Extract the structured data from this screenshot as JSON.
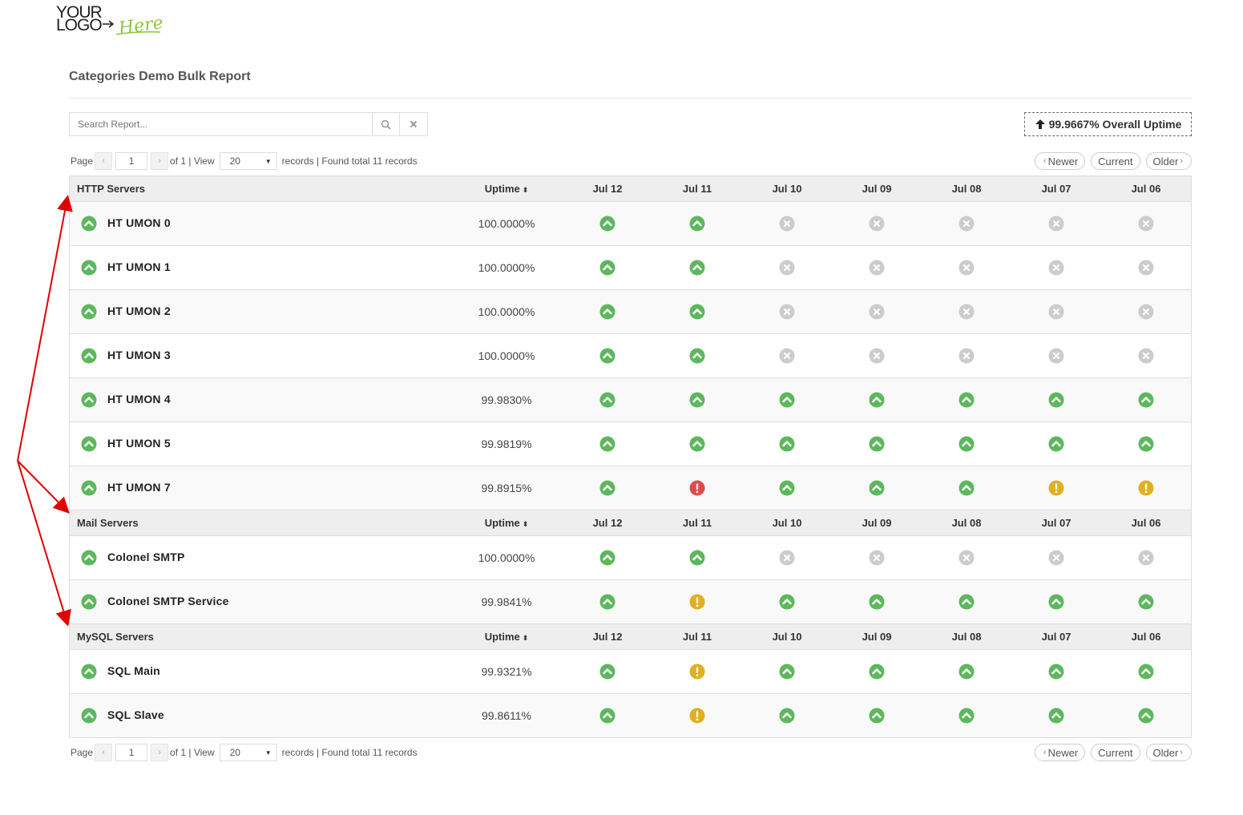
{
  "logo": {
    "line1": "YOUR",
    "line2": "LOGO",
    "accent": "Here"
  },
  "page_title": "Categories Demo Bulk Report",
  "search": {
    "placeholder": "Search Report..."
  },
  "overall_uptime": {
    "value": "99.9667% Overall Uptime",
    "icon": "arrow-up-icon"
  },
  "pager": {
    "page_label": "Page",
    "prev": "‹",
    "page": "1",
    "next": "›",
    "of_text": "of 1 | View",
    "view": "20",
    "records_text": "records | Found total 11 records"
  },
  "nav": {
    "newer": "Newer",
    "current": "Current",
    "older": "Older"
  },
  "columns": {
    "uptime": "Uptime",
    "dates": [
      "Jul 12",
      "Jul 11",
      "Jul 10",
      "Jul 09",
      "Jul 08",
      "Jul 07",
      "Jul 06"
    ]
  },
  "status_colors": {
    "up": "#5cb85c",
    "down": "#e24a4a",
    "warn": "#e0b020",
    "none": "#cccccc"
  },
  "groups": [
    {
      "name": "HTTP Servers",
      "rows": [
        {
          "name": "HT UMON 0",
          "uptime": "100.0000%",
          "days": [
            "up",
            "up",
            "none",
            "none",
            "none",
            "none",
            "none"
          ]
        },
        {
          "name": "HT UMON 1",
          "uptime": "100.0000%",
          "days": [
            "up",
            "up",
            "none",
            "none",
            "none",
            "none",
            "none"
          ]
        },
        {
          "name": "HT UMON 2",
          "uptime": "100.0000%",
          "days": [
            "up",
            "up",
            "none",
            "none",
            "none",
            "none",
            "none"
          ]
        },
        {
          "name": "HT UMON 3",
          "uptime": "100.0000%",
          "days": [
            "up",
            "up",
            "none",
            "none",
            "none",
            "none",
            "none"
          ]
        },
        {
          "name": "HT UMON 4",
          "uptime": "99.9830%",
          "days": [
            "up",
            "up",
            "up",
            "up",
            "up",
            "up",
            "up"
          ]
        },
        {
          "name": "HT UMON 5",
          "uptime": "99.9819%",
          "days": [
            "up",
            "up",
            "up",
            "up",
            "up",
            "up",
            "up"
          ]
        },
        {
          "name": "HT UMON 7",
          "uptime": "99.8915%",
          "days": [
            "up",
            "down",
            "up",
            "up",
            "up",
            "warn",
            "warn"
          ]
        }
      ]
    },
    {
      "name": "Mail Servers",
      "rows": [
        {
          "name": "Colonel SMTP",
          "uptime": "100.0000%",
          "days": [
            "up",
            "up",
            "none",
            "none",
            "none",
            "none",
            "none"
          ]
        },
        {
          "name": "Colonel SMTP Service",
          "uptime": "99.9841%",
          "days": [
            "up",
            "warn",
            "up",
            "up",
            "up",
            "up",
            "up"
          ]
        }
      ]
    },
    {
      "name": "MySQL Servers",
      "rows": [
        {
          "name": "SQL Main",
          "uptime": "99.9321%",
          "days": [
            "up",
            "warn",
            "up",
            "up",
            "up",
            "up",
            "up"
          ]
        },
        {
          "name": "SQL Slave",
          "uptime": "99.8611%",
          "days": [
            "up",
            "warn",
            "up",
            "up",
            "up",
            "up",
            "up"
          ]
        }
      ]
    }
  ]
}
